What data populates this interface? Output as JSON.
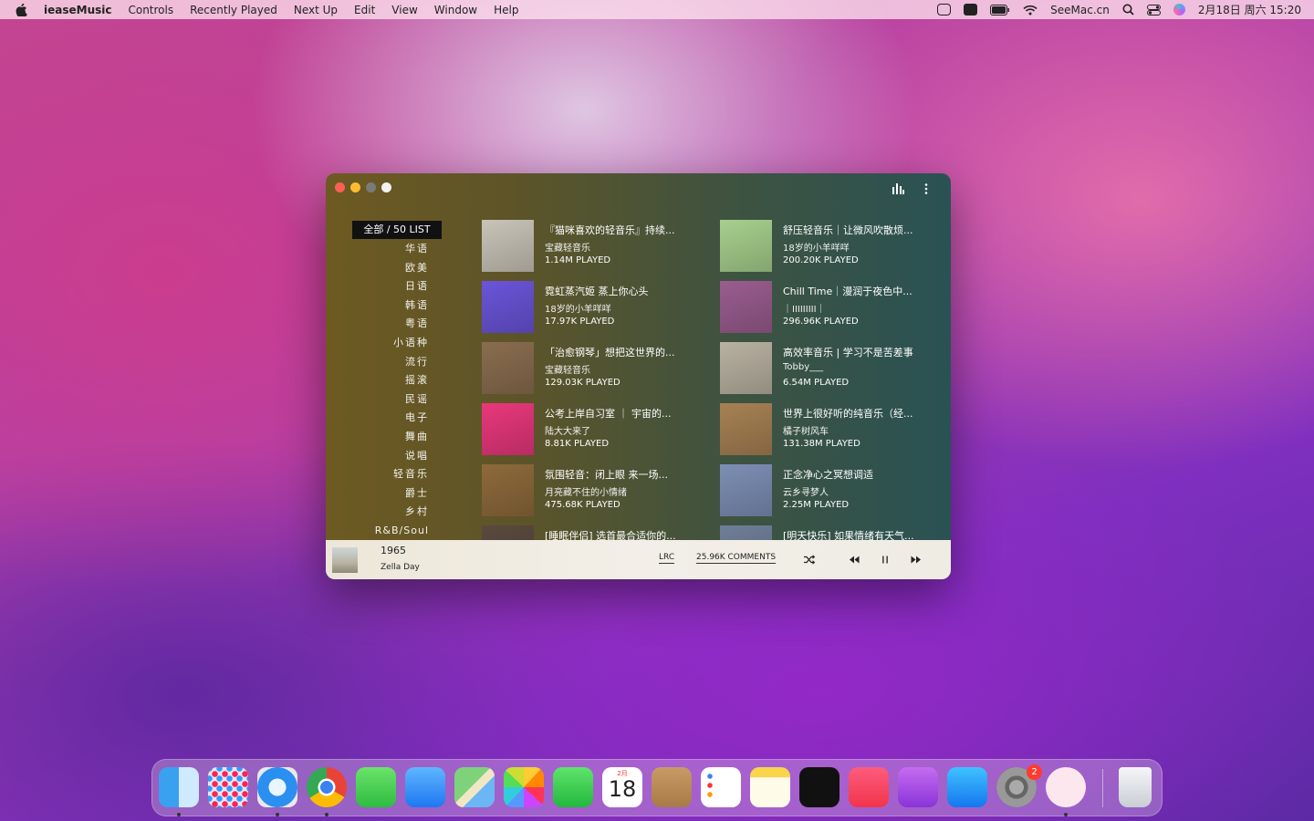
{
  "menubar": {
    "app_name": "ieaseMusic",
    "items": [
      "Controls",
      "Recently Played",
      "Next Up",
      "Edit",
      "View",
      "Window",
      "Help"
    ],
    "right_text": "SeeMac.cn",
    "datetime": "2月18日 周六 15:20"
  },
  "window": {
    "categories_active": "全部 / 50 LIST",
    "categories": [
      "华语",
      "欧美",
      "日语",
      "韩语",
      "粤语",
      "小语种",
      "流行",
      "摇滚",
      "民谣",
      "电子",
      "舞曲",
      "说唱",
      "轻音乐",
      "爵士",
      "乡村",
      "R&B/Soul"
    ],
    "playlists": [
      {
        "title": "『猫咪喜欢的轻音乐』持续...",
        "creator": "宝藏轻音乐",
        "played": "1.14M PLAYED",
        "cover_color": "#c9c4b8"
      },
      {
        "title": "舒压轻音乐｜让微风吹散烦...",
        "creator": "18岁的小羊咩咩",
        "played": "200.20K PLAYED",
        "cover_color": "#a7d08d"
      },
      {
        "title": "霓虹蒸汽姬 蒸上你心头",
        "creator": "18岁的小羊咩咩",
        "played": "17.97K PLAYED",
        "cover_color": "#6a55d9"
      },
      {
        "title": "Chill Time｜漫润于夜色中...",
        "creator": "｜IIIIIIIII｜",
        "played": "296.96K PLAYED",
        "cover_color": "#9a5d8f"
      },
      {
        "title": "「治愈钢琴」想把这世界的...",
        "creator": "宝藏轻音乐",
        "played": "129.03K PLAYED",
        "cover_color": "#8a6d4f"
      },
      {
        "title": "高效率音乐 | 学习不是苦差事",
        "creator": "Tobby___",
        "played": "6.54M PLAYED",
        "cover_color": "#b9b2a2"
      },
      {
        "title": "公考上岸自习室 ｜ 宇宙的...",
        "creator": "陆大大来了",
        "played": "8.81K PLAYED",
        "cover_color": "#e8387c"
      },
      {
        "title": "世界上很好听的纯音乐（经...",
        "creator": "橘子树风车",
        "played": "131.38M PLAYED",
        "cover_color": "#a78153"
      },
      {
        "title": "氛围轻音：闭上眼 来一场...",
        "creator": "月亮藏不住的小情绪",
        "played": "475.68K PLAYED",
        "cover_color": "#8e6a3c"
      },
      {
        "title": "正念净心之冥想调适",
        "creator": "云乡寻梦人",
        "played": "2.25M PLAYED",
        "cover_color": "#7d8fb5"
      },
      {
        "title": "[睡眠伴侣] 选首最合适你的...",
        "creator": "",
        "played": "",
        "cover_color": "#5a4a3e"
      },
      {
        "title": "[明天快乐] 如果情绪有天气...",
        "creator": "",
        "played": "",
        "cover_color": "#6f7f98"
      }
    ]
  },
  "player": {
    "song": "1965",
    "artist": "Zella Day",
    "lrc_label": "LRC",
    "comments_label": "25.96K COMMENTS"
  },
  "dock": {
    "calendar_month": "2月",
    "calendar_day": "18",
    "badge": "2"
  }
}
